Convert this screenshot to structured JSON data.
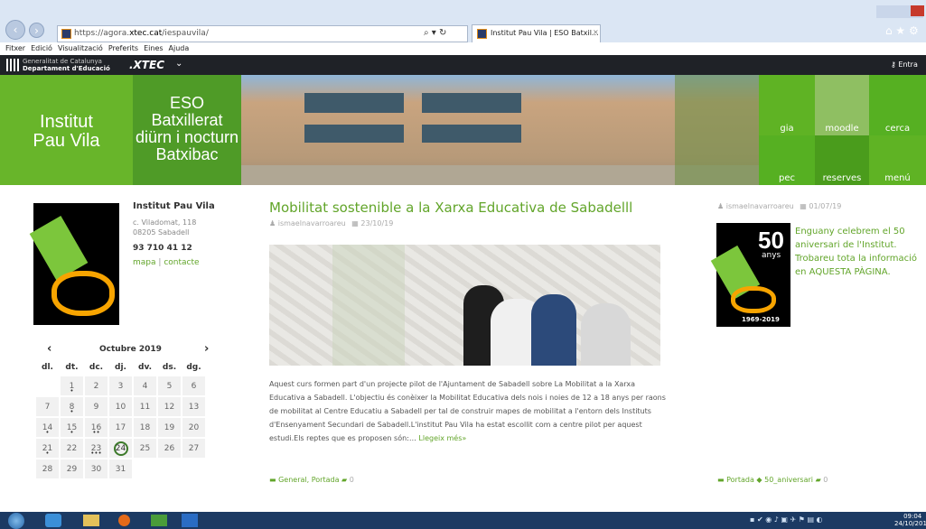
{
  "browser": {
    "url_prefix": "https://agora.",
    "url_domain": "xtec.cat",
    "url_suffix": "/iespauvila/",
    "tab_title": "Institut Pau Vila | ESO Batxil...",
    "tab_close": "×",
    "search_glyph": "⌕ ▾ ↻"
  },
  "menu": [
    "Fitxer",
    "Edició",
    "Visualització",
    "Preferits",
    "Eines",
    "Ajuda"
  ],
  "gencat": {
    "line1": "Generalitat de Catalunya",
    "line2": "Departament d'Educació",
    "xtec": ".XTEC",
    "login": "Entra"
  },
  "banner": {
    "school_line1": "Institut",
    "school_line2": "Pau Vila",
    "studies": [
      "ESO",
      "Batxillerat",
      "diürn i nocturn",
      "Batxibac"
    ],
    "tiles": [
      "gia",
      "moodle",
      "cerca",
      "pec",
      "reserves",
      "menú"
    ]
  },
  "sidebar": {
    "name": "Institut Pau Vila",
    "address1": "c. Viladomat, 118",
    "address2": "08205 Sabadell",
    "phone": "93 710 41 12",
    "link_map": "mapa",
    "separator": "|",
    "link_contact": "contacte",
    "calendar": {
      "prev": "‹",
      "next": "›",
      "month": "Octubre 2019",
      "weekdays": [
        "dl.",
        "dt.",
        "dc.",
        "dj.",
        "dv.",
        "ds.",
        "dg."
      ],
      "weeks": [
        [
          "",
          "1",
          "2",
          "3",
          "4",
          "5",
          "6"
        ],
        [
          "7",
          "8",
          "9",
          "10",
          "11",
          "12",
          "13"
        ],
        [
          "14",
          "15",
          "16",
          "17",
          "18",
          "19",
          "20"
        ],
        [
          "21",
          "22",
          "23",
          "24",
          "25",
          "26",
          "27"
        ],
        [
          "28",
          "29",
          "30",
          "31",
          "",
          "",
          ""
        ]
      ]
    }
  },
  "post": {
    "title": "Mobilitat sostenible a la Xarxa Educativa de Sabadelll",
    "author": "ismaelnavarroareu",
    "date": "23/10/19",
    "excerpt": "Aquest curs formen part d'un projecte pilot de l'Ajuntament de Sabadell sobre La Mobilitat a la Xarxa Educativa a Sabadell. L'objectiu és conèixer la Mobilitat Educativa dels nois i noies de 12 a 18 anys per raons de mobilitat al Centre Educatiu a Sabadell per tal de construir mapes de mobilitat a l'entorn dels Instituts d'Ensenyament Secundari de Sabadell.L'institut Pau Vila ha estat escollit com a centre pilot per aquest estudi.Els reptes que es proposen són:…",
    "read_more": "Llegeix més»",
    "categories": "General, Portada",
    "comments": "0"
  },
  "aside": {
    "author": "ismaelnavarroareu",
    "date": "01/07/19",
    "logo_big": "50",
    "logo_small": "anys",
    "logo_years": "1969-2019",
    "text": "Enguany celebrem el 50 aniversari de l'Institut. Trobareu tota la informació en AQUESTA PÀGINA.",
    "categories": "Portada",
    "tags": "50_aniversari",
    "comments": "0"
  },
  "taskbar": {
    "time": "09:04",
    "date": "24/10/2019"
  }
}
